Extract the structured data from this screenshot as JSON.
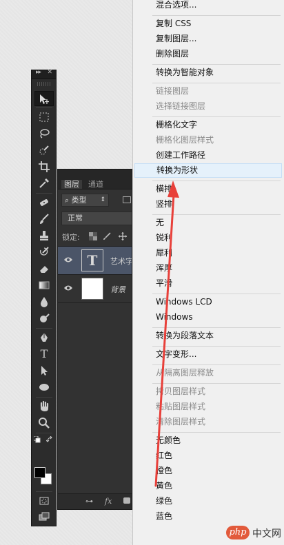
{
  "tools_panel": {
    "collapse_icon": "double-chevron-icon",
    "close_icon": "close-icon",
    "tools": [
      {
        "name": "move-tool",
        "icon": "move-icon",
        "active": true
      },
      {
        "name": "marquee-tool",
        "icon": "marquee-icon"
      },
      {
        "name": "lasso-tool",
        "icon": "lasso-icon"
      },
      {
        "name": "quick-select-tool",
        "icon": "quick-select-icon"
      },
      {
        "name": "crop-tool",
        "icon": "crop-icon"
      },
      {
        "name": "eyedropper-tool",
        "icon": "eyedropper-icon"
      },
      {
        "name": "healing-tool",
        "icon": "bandage-icon"
      },
      {
        "name": "brush-tool",
        "icon": "brush-icon"
      },
      {
        "name": "stamp-tool",
        "icon": "stamp-icon"
      },
      {
        "name": "history-brush-tool",
        "icon": "history-brush-icon"
      },
      {
        "name": "eraser-tool",
        "icon": "eraser-icon"
      },
      {
        "name": "gradient-tool",
        "icon": "gradient-icon"
      },
      {
        "name": "blur-tool",
        "icon": "drop-icon"
      },
      {
        "name": "dodge-tool",
        "icon": "dodge-icon"
      },
      {
        "name": "pen-tool",
        "icon": "pen-icon"
      },
      {
        "name": "type-tool",
        "icon": "type-icon",
        "glyph": "T"
      },
      {
        "name": "path-select-tool",
        "icon": "arrow-icon"
      },
      {
        "name": "shape-tool",
        "icon": "ellipse-icon"
      },
      {
        "name": "hand-tool",
        "icon": "hand-icon"
      },
      {
        "name": "zoom-tool",
        "icon": "zoom-icon"
      }
    ],
    "foreground_color": "#000000",
    "background_color": "#ffffff"
  },
  "layers_panel": {
    "tabs": [
      {
        "label": "图层",
        "active": true
      },
      {
        "label": "通道",
        "active": false
      }
    ],
    "filter": {
      "label": "类型",
      "icon": "search-icon"
    },
    "blend_mode": "正常",
    "lock_label": "锁定:",
    "layers": [
      {
        "name": "艺术字",
        "thumb": "T",
        "selected": true,
        "visible": true
      },
      {
        "name": "背景",
        "thumb": "white",
        "selected": false,
        "visible": true
      }
    ],
    "footer_icons": [
      "link-icon",
      "fx-icon",
      "mask-icon"
    ],
    "footer_fx": "fx"
  },
  "context_menu": {
    "items": [
      {
        "label": "混合选项...",
        "enabled": true
      },
      {
        "sep": true
      },
      {
        "label": "复制 CSS",
        "enabled": true
      },
      {
        "label": "复制图层...",
        "enabled": true
      },
      {
        "label": "删除图层",
        "enabled": true
      },
      {
        "sep": true
      },
      {
        "label": "转换为智能对象",
        "enabled": true
      },
      {
        "sep": true
      },
      {
        "label": "链接图层",
        "enabled": false
      },
      {
        "label": "选择链接图层",
        "enabled": false
      },
      {
        "sep": true
      },
      {
        "label": "栅格化文字",
        "enabled": true
      },
      {
        "label": "栅格化图层样式",
        "enabled": false
      },
      {
        "label": "创建工作路径",
        "enabled": true
      },
      {
        "label": "转换为形状",
        "enabled": true,
        "highlighted": true
      },
      {
        "sep": true
      },
      {
        "label": "横排",
        "enabled": true
      },
      {
        "label": "竖排",
        "enabled": true
      },
      {
        "sep": true
      },
      {
        "label": "无",
        "enabled": true
      },
      {
        "label": "锐利",
        "enabled": true
      },
      {
        "label": "犀利",
        "enabled": true
      },
      {
        "label": "浑厚",
        "enabled": true
      },
      {
        "label": "平滑",
        "enabled": true
      },
      {
        "sep": true
      },
      {
        "label": "Windows LCD",
        "enabled": true
      },
      {
        "label": "Windows",
        "enabled": true
      },
      {
        "sep": true
      },
      {
        "label": "转换为段落文本",
        "enabled": true
      },
      {
        "sep": true
      },
      {
        "label": "文字变形...",
        "enabled": true
      },
      {
        "sep": true
      },
      {
        "label": "从隔离图层释放",
        "enabled": false
      },
      {
        "sep": true
      },
      {
        "label": "拷贝图层样式",
        "enabled": false
      },
      {
        "label": "粘贴图层样式",
        "enabled": false
      },
      {
        "label": "清除图层样式",
        "enabled": false
      },
      {
        "sep": true
      },
      {
        "label": "无颜色",
        "enabled": true
      },
      {
        "label": "红色",
        "enabled": true
      },
      {
        "label": "橙色",
        "enabled": true
      },
      {
        "label": "黄色",
        "enabled": true
      },
      {
        "label": "绿色",
        "enabled": true
      },
      {
        "label": "蓝色",
        "enabled": true
      }
    ]
  },
  "annotation": {
    "arrow_color": "#e8403a"
  },
  "watermark": {
    "logo": "php",
    "text": "中文网"
  }
}
